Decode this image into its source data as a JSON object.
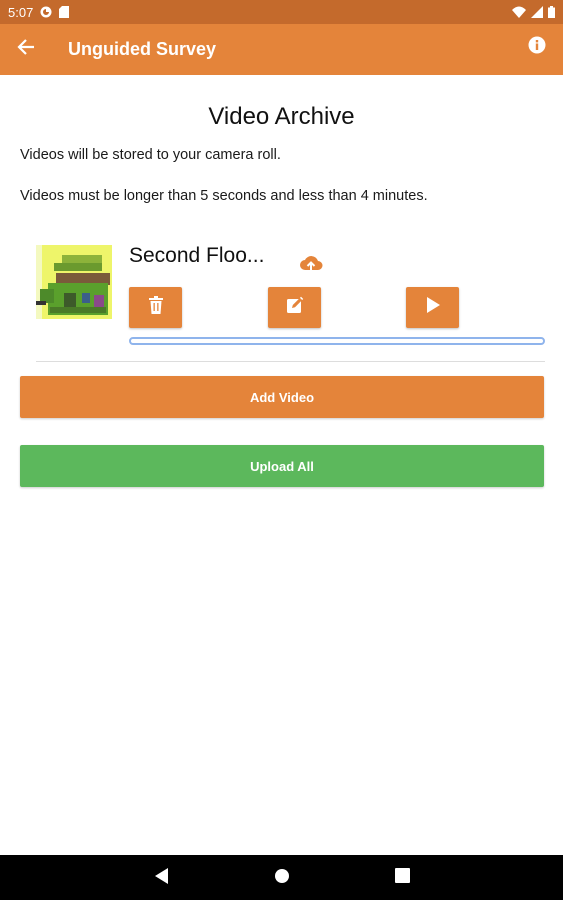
{
  "status_bar": {
    "time": "5:07",
    "icons": [
      "notification-icon",
      "sim-card-icon",
      "wifi-icon",
      "signal-icon",
      "battery-icon"
    ]
  },
  "app_bar": {
    "title": "Unguided Survey",
    "back_icon": "arrow-back-icon",
    "info_icon": "info-icon"
  },
  "page": {
    "title": "Video Archive",
    "description_1": "Videos will be stored to your camera roll.",
    "description_2": "Videos must be longer than 5 seconds and less than 4 minutes."
  },
  "videos": [
    {
      "name": "Second Floo...",
      "upload_progress": 0,
      "actions": [
        "delete-icon",
        "edit-icon",
        "play-icon"
      ]
    }
  ],
  "buttons": {
    "add_video": "Add Video",
    "upload_all": "Upload All"
  },
  "colors": {
    "primary": "#e4843a",
    "primary_dark": "#c46a2c",
    "success": "#5cb85c",
    "progress": "#8fb4ec"
  },
  "nav_bar": {
    "icons": [
      "back-triangle-icon",
      "home-circle-icon",
      "recents-square-icon"
    ]
  }
}
